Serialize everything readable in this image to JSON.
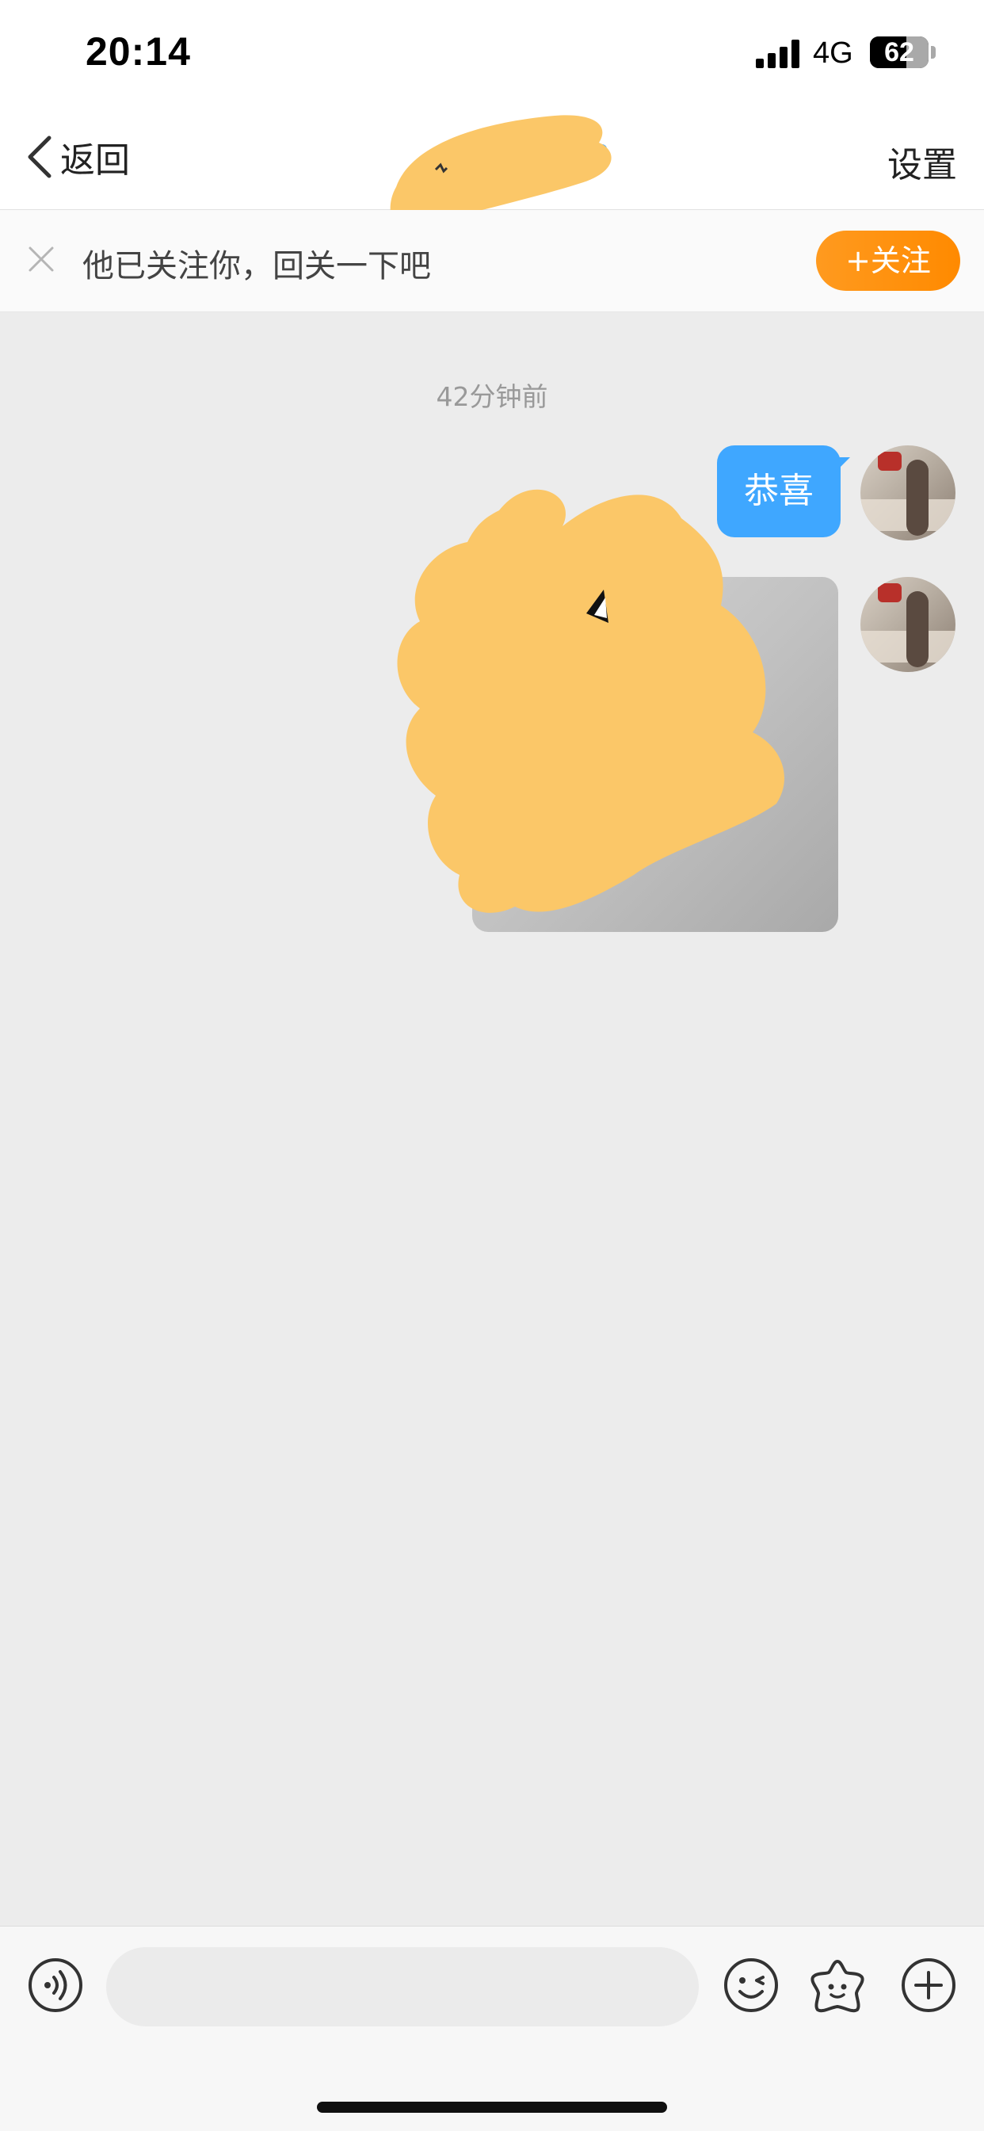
{
  "status_bar": {
    "time": "20:14",
    "network": "4G",
    "battery_level": 62,
    "battery_label": "62"
  },
  "nav": {
    "back_label": "返回",
    "title": "",
    "settings_label": "设置",
    "back_icon": "chevron-left-icon"
  },
  "banner": {
    "text": "他已关注你，回关一下吧",
    "follow_label": "+关注",
    "close_icon": "close-icon",
    "follow_color": "#ff8a00"
  },
  "chat": {
    "timestamp": "42分钟前",
    "messages": [
      {
        "type": "text",
        "text": "恭喜",
        "sender": "self"
      },
      {
        "type": "image",
        "sender": "self"
      }
    ],
    "bubble_color": "#3fa7ff",
    "background_color": "#ececec"
  },
  "input_bar": {
    "placeholder": "",
    "icons": [
      "voice-icon",
      "emoji-icon",
      "sticker-icon",
      "plus-icon"
    ]
  }
}
